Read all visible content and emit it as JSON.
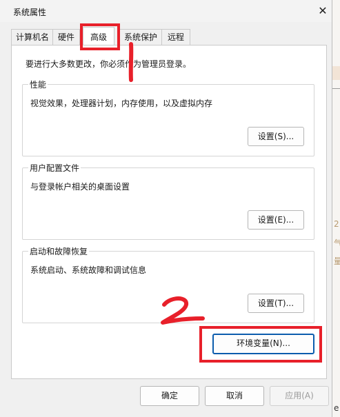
{
  "window": {
    "title": "系统属性"
  },
  "tabs": [
    {
      "label": "计算机名"
    },
    {
      "label": "硬件"
    },
    {
      "label": "高级"
    },
    {
      "label": "系统保护"
    },
    {
      "label": "远程"
    }
  ],
  "notice": "要进行大多数更改，你必须作为管理员登录。",
  "groups": [
    {
      "title": "性能",
      "desc": "视觉效果，处理器计划，内存使用，以及虚拟内存",
      "button": "设置(S)..."
    },
    {
      "title": "用户配置文件",
      "desc": "与登录帐户相关的桌面设置",
      "button": "设置(E)..."
    },
    {
      "title": "启动和故障恢复",
      "desc": "系统启动、系统故障和调试信息",
      "button": "设置(T)..."
    }
  ],
  "env_button": "环境变量(N)...",
  "footer": {
    "ok": "确定",
    "cancel": "取消",
    "apply": "应用(A)"
  },
  "annotations": {
    "step1": "1",
    "step2": "2",
    "color": "#e8202a"
  },
  "background_fragments": {
    "chars": [
      "2",
      "气",
      "量",
      "e"
    ]
  }
}
